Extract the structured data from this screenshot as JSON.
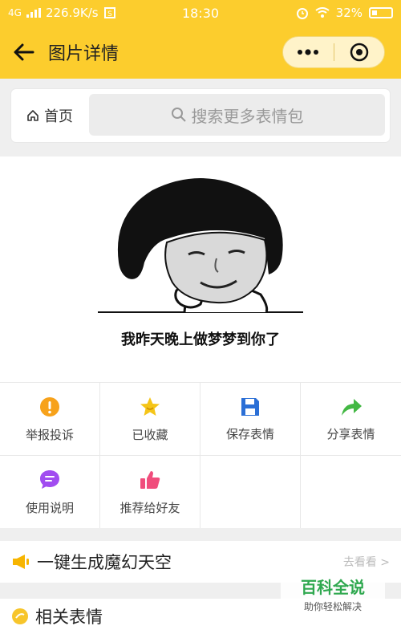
{
  "status_bar": {
    "network": "4G",
    "speed": "226.9K/s",
    "time": "18:30",
    "battery": "32%"
  },
  "nav": {
    "title": "图片详情"
  },
  "search": {
    "home_label": "首页",
    "placeholder": "搜索更多表情包"
  },
  "meme": {
    "caption": "我昨天晚上做梦梦到你了"
  },
  "actions": [
    {
      "label": "举报投诉",
      "icon": "report-icon",
      "color": "#f7a21b"
    },
    {
      "label": "已收藏",
      "icon": "star-icon",
      "color": "#f5c518"
    },
    {
      "label": "保存表情",
      "icon": "save-icon",
      "color": "#2b6fd6"
    },
    {
      "label": "分享表情",
      "icon": "share-icon",
      "color": "#43b844"
    },
    {
      "label": "使用说明",
      "icon": "help-icon",
      "color": "#a14cf0"
    },
    {
      "label": "推荐给好友",
      "icon": "thumbs-up-icon",
      "color": "#f04d7c"
    }
  ],
  "banner": {
    "text": "一键生成魔幻天空",
    "more": "去看看 >"
  },
  "related": {
    "title": "相关表情"
  },
  "watermark": {
    "title": "百科全说",
    "subtitle": "助你轻松解决"
  },
  "colors": {
    "brand": "#fccd2d"
  }
}
